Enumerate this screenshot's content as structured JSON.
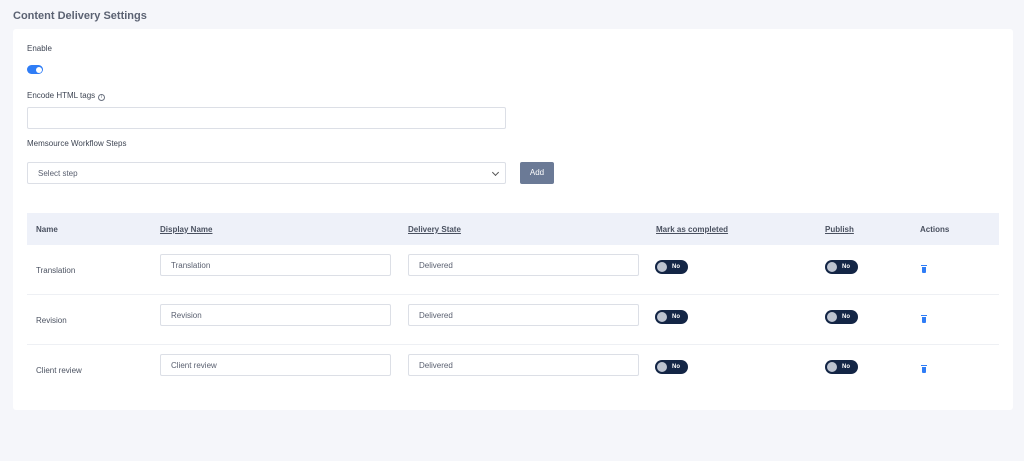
{
  "page": {
    "title": "Content Delivery Settings"
  },
  "settings": {
    "enable_label": "Enable",
    "enable_on": true,
    "encode_label": "Encode HTML tags",
    "encode_value": "",
    "workflow_label": "Memsource Workflow Steps",
    "select_placeholder": "Select step",
    "add_label": "Add"
  },
  "table": {
    "headers": [
      "Name",
      "Display Name",
      "Delivery State",
      "Mark as completed",
      "Publish",
      "Actions"
    ],
    "rows": [
      {
        "name": "Translation",
        "display_name": "Translation",
        "delivery_state": "Delivered",
        "mark_completed": "No",
        "publish": "No"
      },
      {
        "name": "Revision",
        "display_name": "Revision",
        "delivery_state": "Delivered",
        "mark_completed": "No",
        "publish": "No"
      },
      {
        "name": "Client review",
        "display_name": "Client review",
        "delivery_state": "Delivered",
        "mark_completed": "No",
        "publish": "No"
      }
    ]
  },
  "colors": {
    "accent": "#2f7df6",
    "toggle_dark": "#132545",
    "button": "#6b7a96",
    "header_bg": "#eef1f9"
  }
}
